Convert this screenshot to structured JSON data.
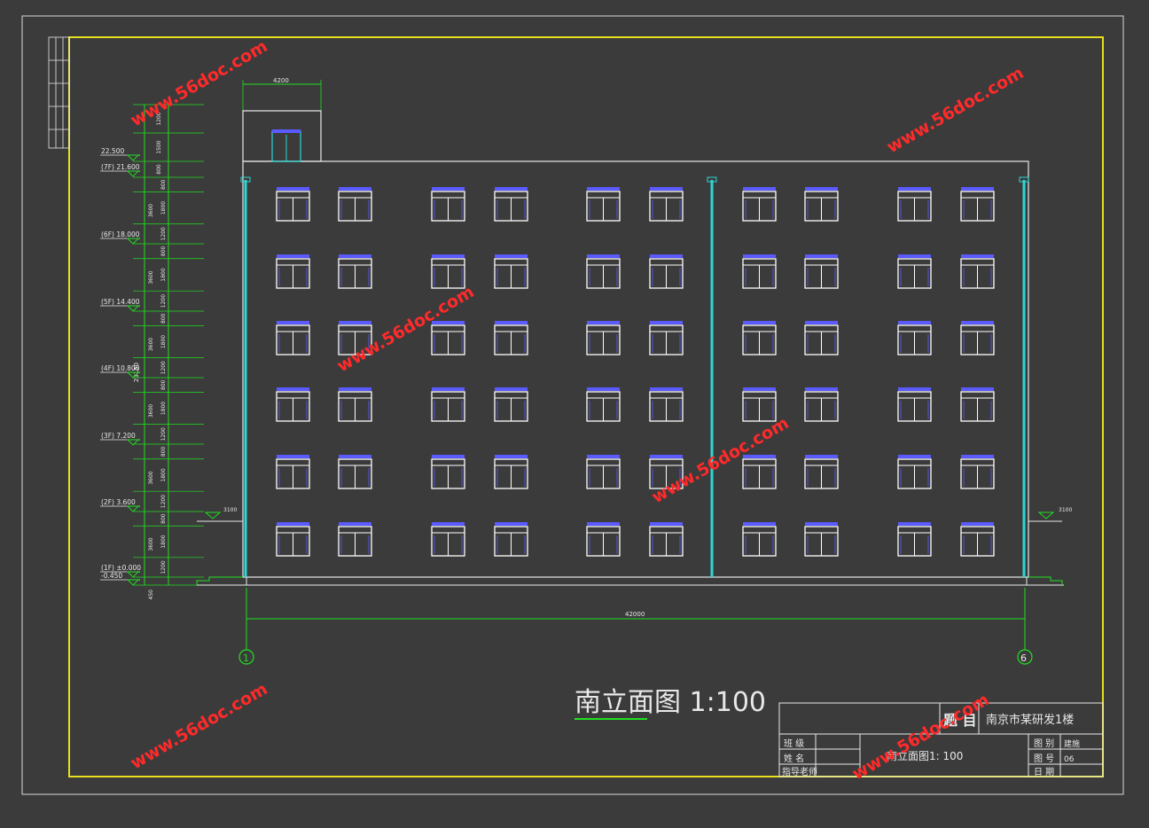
{
  "drawing": {
    "title": "南立面图 1:100",
    "top_dimension": "4200",
    "total_dimension": "42000",
    "total_height": "23150",
    "axis_left": "1",
    "axis_right": "6",
    "ground_left": "3100",
    "ground_right": "3100",
    "base_dim": "450"
  },
  "levels": [
    {
      "label": "22.500"
    },
    {
      "label": "(7F) 21.600"
    },
    {
      "label": "(6F) 18.000"
    },
    {
      "label": "(5F) 14.400"
    },
    {
      "label": "(4F) 10.800"
    },
    {
      "label": "(3F) 7.200"
    },
    {
      "label": "(2F) 3.600"
    },
    {
      "label": "(1F) ±0.000"
    },
    {
      "label": "-0.450"
    }
  ],
  "floor_dims": [
    "3600",
    "3600",
    "3600",
    "3600",
    "3600",
    "3600"
  ],
  "sub_dims": {
    "upper": [
      "1200",
      "1500",
      "800"
    ],
    "per_floor": [
      "800",
      "1800",
      "1200"
    ]
  },
  "title_block": {
    "subject_label": "题 目",
    "subject_value": "南京市某研发1楼",
    "rows": [
      {
        "label": "班 级",
        "right_label": "图 别",
        "right_value": "建施"
      },
      {
        "label": "姓 名",
        "right_label": "图 号",
        "right_value": "06"
      },
      {
        "label": "指导老师",
        "right_label": "日 期",
        "right_value": ""
      }
    ],
    "drawing_name": "南立面图1: 100"
  },
  "watermark": "www.56doc.com",
  "colors": {
    "background": "#3b3b3b",
    "frame": "#e6e01e",
    "dimension": "#20e020",
    "wall": "#e8e8e8",
    "window_frame": "#ffffff",
    "window_head": "#5a5aff",
    "pipe": "#2ed6d6",
    "watermark": "#ff2a2a"
  }
}
